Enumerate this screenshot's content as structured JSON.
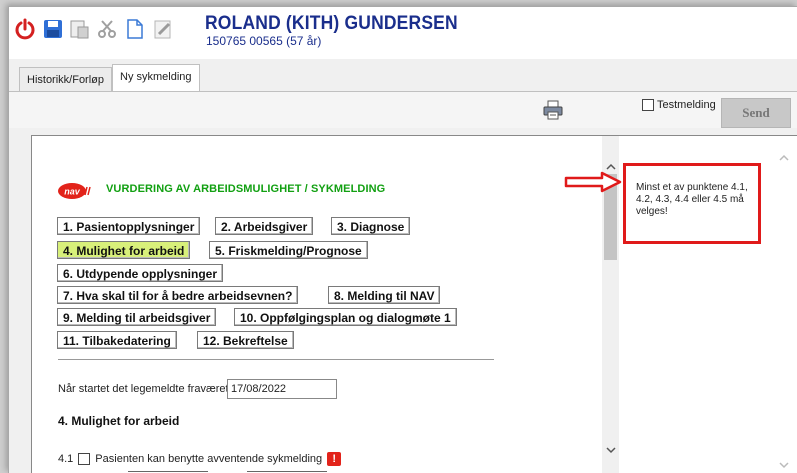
{
  "toolbar": {
    "icons": [
      "power-icon",
      "save-icon",
      "sign-icon",
      "cut-icon",
      "new-document-icon",
      "edit-icon"
    ],
    "patient_name": "ROLAND (KITH) GUNDERSEN",
    "patient_id": "150765 00565 (57 år)"
  },
  "tabs": [
    {
      "label": "Historikk/Forløp",
      "active": false
    },
    {
      "label": "Ny sykmelding",
      "active": true
    }
  ],
  "actions": {
    "testmelding_label": "Testmelding",
    "testmelding_checked": false,
    "send_label": "Send"
  },
  "form": {
    "logo_text": "nav",
    "title": "VURDERING AV ARBEIDSMULIGHET / SYKMELDING",
    "sections": [
      {
        "label": "1. Pasientopplysninger",
        "active": false
      },
      {
        "label": "2. Arbeidsgiver",
        "active": false
      },
      {
        "label": "3. Diagnose",
        "active": false
      },
      {
        "label": "4. Mulighet for arbeid",
        "active": true
      },
      {
        "label": "5. Friskmelding/Prognose",
        "active": false
      },
      {
        "label": "6. Utdypende opplysninger",
        "active": false
      },
      {
        "label": "7. Hva skal til for å bedre arbeidsevnen?",
        "active": false
      },
      {
        "label": "8. Melding til NAV",
        "active": false
      },
      {
        "label": "9. Melding til arbeidsgiver",
        "active": false
      },
      {
        "label": "10. Oppfølgingsplan og dialogmøte 1",
        "active": false
      },
      {
        "label": "11. Tilbakedatering",
        "active": false
      },
      {
        "label": "12. Bekreftelse",
        "active": false
      }
    ],
    "absence_question": "Når startet det legemeldte fraværet?",
    "absence_date": "17/08/2022",
    "section_heading": "4. Mulighet for arbeid",
    "q41_number": "4.1",
    "q41_label": "Pasienten kan benytte avventende sykmelding",
    "q41_checked": false
  },
  "warning": {
    "text": "Minst et av punktene 4.1, 4.2, 4.3, 4.4 eller 4.5 må velges!",
    "border_color": "#e01a1a"
  },
  "colors": {
    "accent_title": "#12a012",
    "patient_name": "#1a2e8c",
    "active_section": "#d8f07a",
    "nav_logo": "#e2231a"
  }
}
